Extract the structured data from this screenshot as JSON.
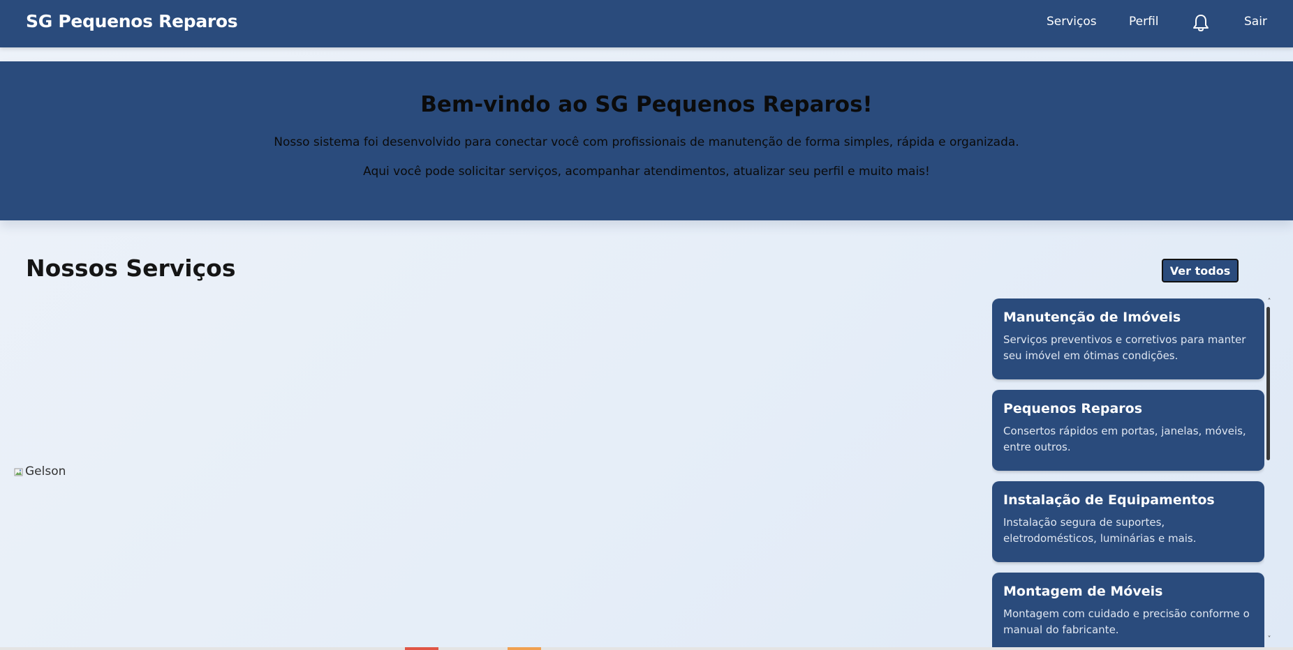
{
  "nav": {
    "brand": "SG Pequenos Reparos",
    "links": [
      "Serviços",
      "Perfil"
    ],
    "logout": "Sair",
    "bell_icon": "bell-icon"
  },
  "hero": {
    "title": "Bem-vindo ao SG Pequenos Reparos!",
    "p1": "Nosso sistema foi desenvolvido para conectar você com profissionais de manutenção de forma simples, rápida e organizada.",
    "p2": "Aqui você pode solicitar serviços, acompanhar atendimentos, atualizar seu perfil e muito mais!"
  },
  "services": {
    "title": "Nossos Serviços",
    "view_all": "Ver todos",
    "image_alt": "Gelson",
    "cards": [
      {
        "title": "Manutenção de Imóveis",
        "desc": "Serviços preventivos e corretivos para manter seu imóvel em ótimas condições."
      },
      {
        "title": "Pequenos Reparos",
        "desc": "Consertos rápidos em portas, janelas, móveis, entre outros."
      },
      {
        "title": "Instalação de Equipamentos",
        "desc": "Instalação segura de suportes, eletrodomésticos, luminárias e mais."
      },
      {
        "title": "Montagem de Móveis",
        "desc": "Montagem com cuidado e precisão conforme o manual do fabricante."
      }
    ]
  },
  "colors": {
    "primary": "#2a4b7c",
    "background": "#e8eff8"
  }
}
